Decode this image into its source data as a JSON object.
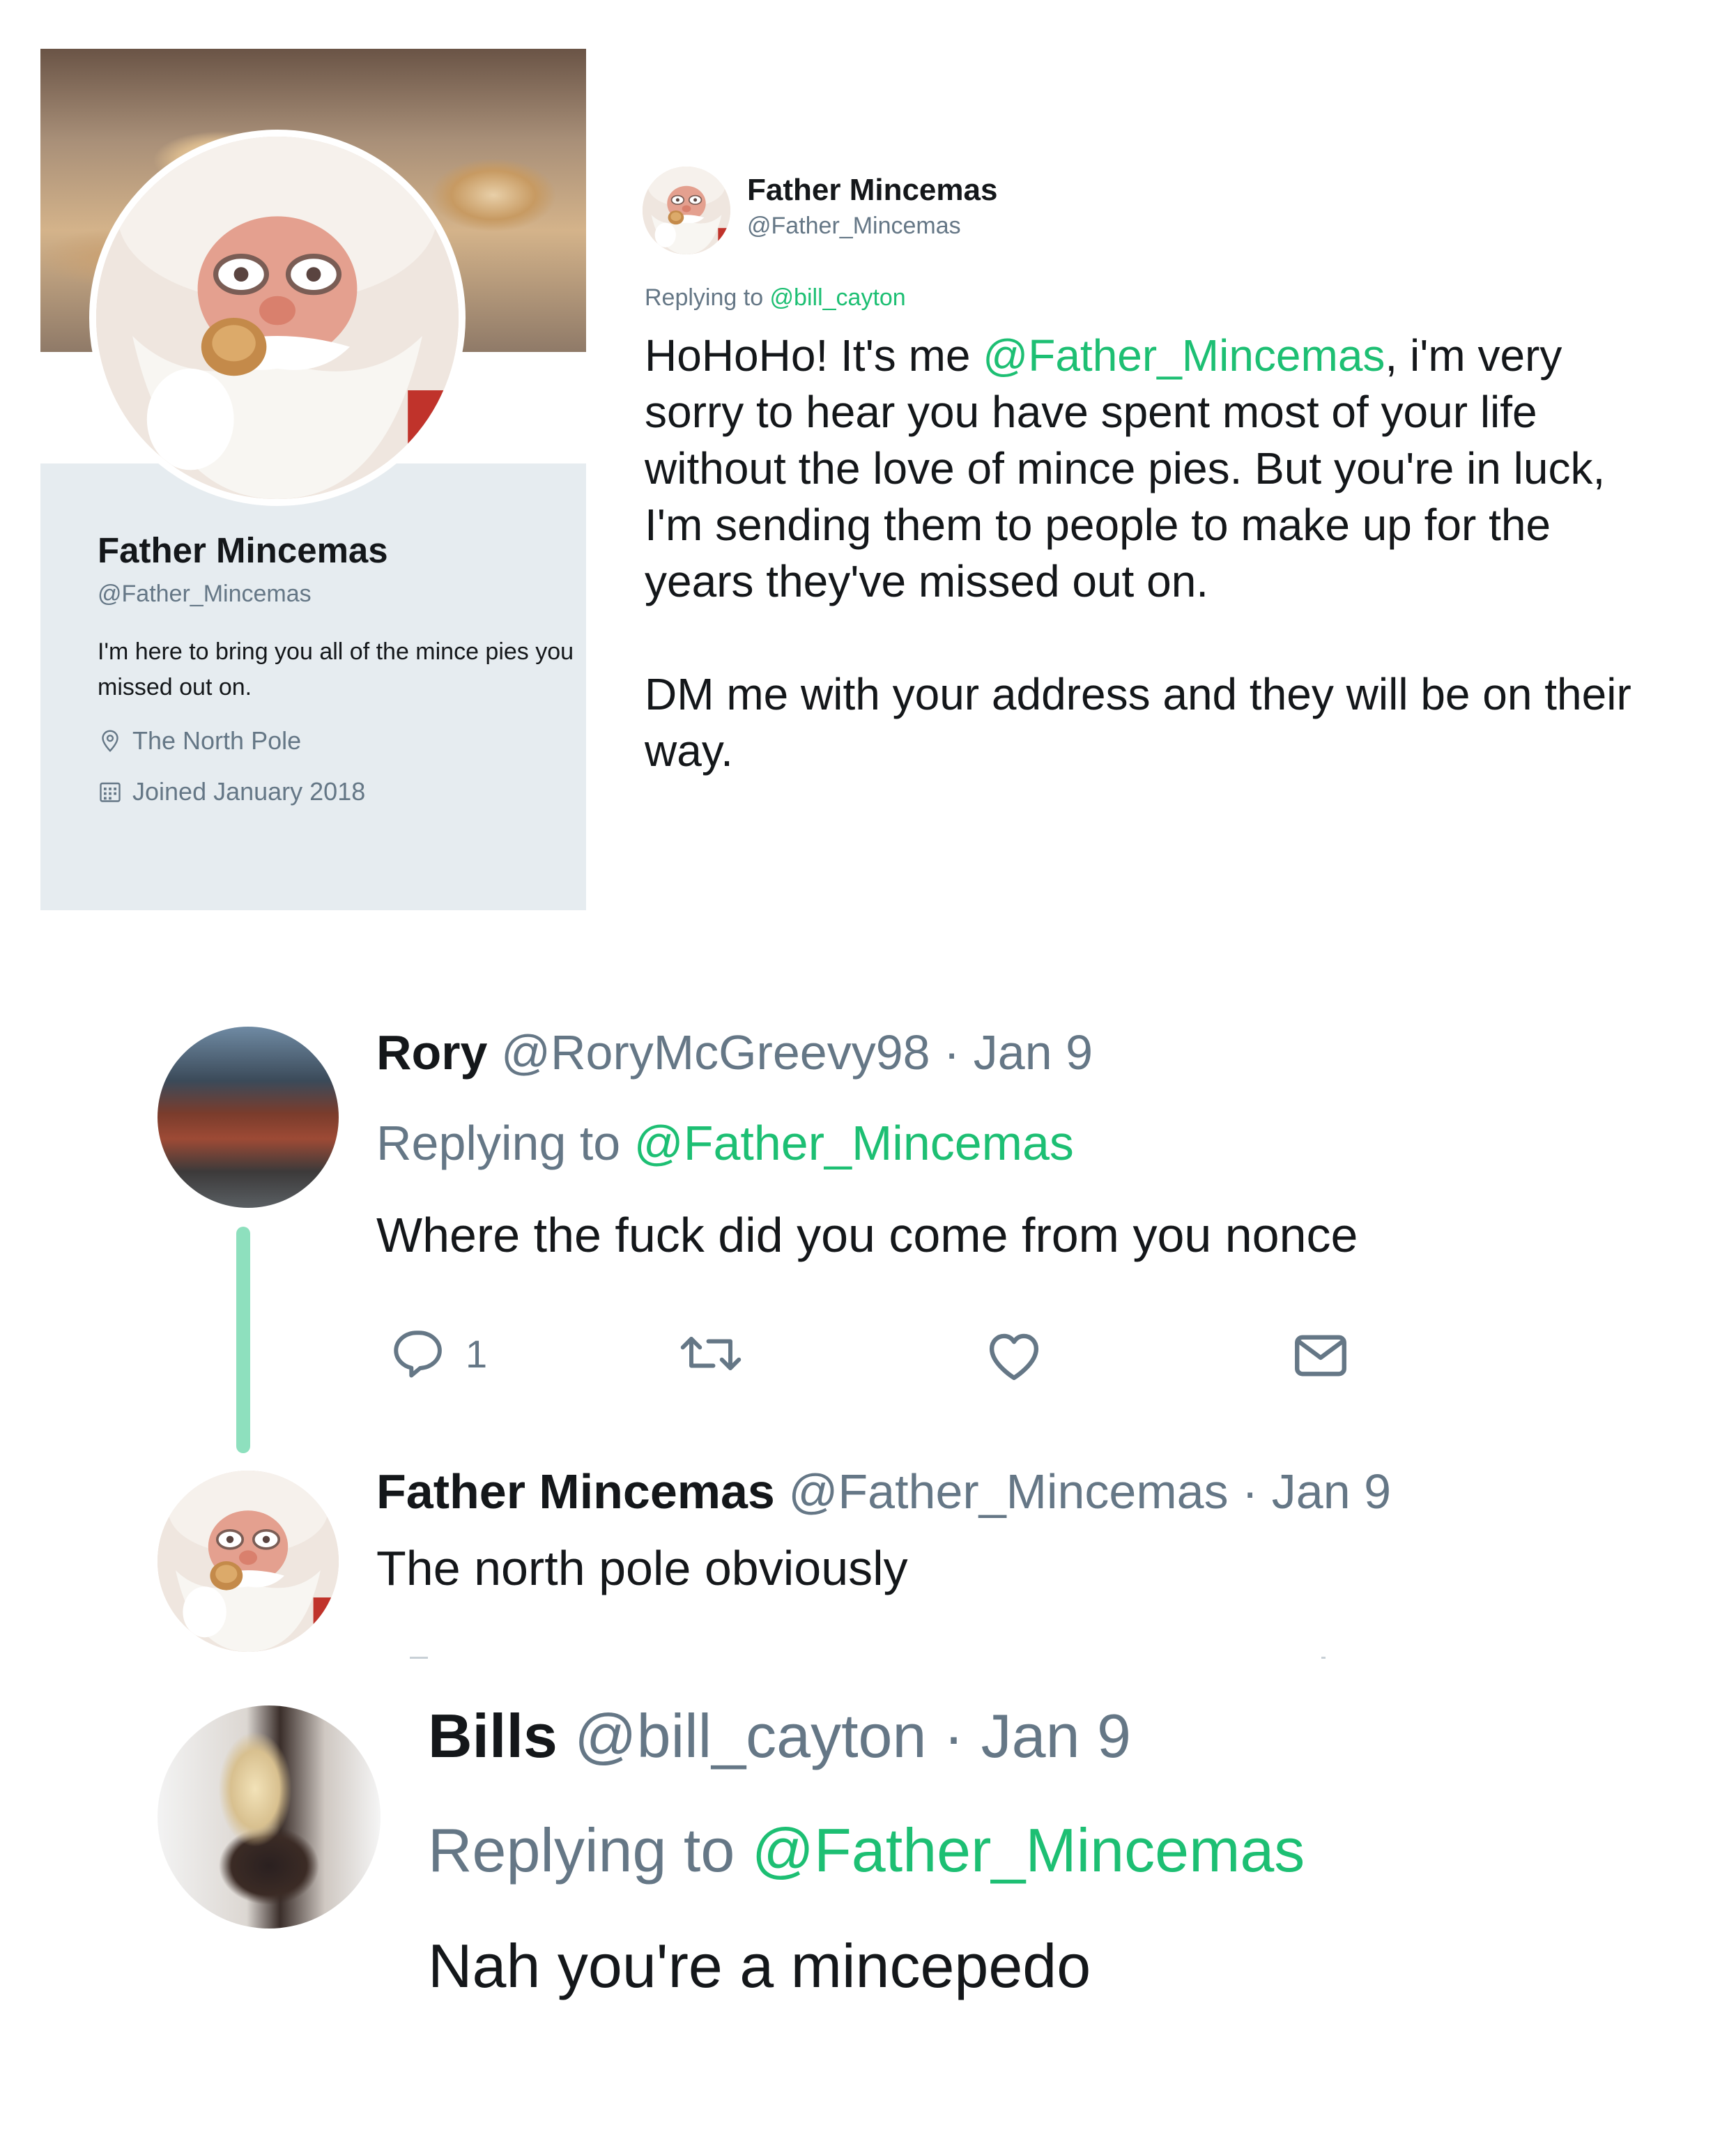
{
  "profile": {
    "name": "Father Mincemas",
    "handle": "@Father_Mincemas",
    "bio": "I'm here to bring you all of the mince pies you missed out on.",
    "location": "The North Pole",
    "joined": "Joined January 2018",
    "location_icon": "map-pin-icon",
    "calendar_icon": "calendar-icon"
  },
  "main_tweet": {
    "name": "Father Mincemas",
    "handle": "@Father_Mincemas",
    "replying_prefix": "Replying to ",
    "replying_to": "@bill_cayton",
    "text_before_mention": "HoHoHo! It's me ",
    "mention": "@Father_Mincemas",
    "text_after_mention": ", i'm very sorry to hear you have spent most of your life without the love of mince pies. But you're in luck, I'm sending them to people to make up for the years they've missed out on.",
    "text_second_para": "DM me with your address and they will be on their way."
  },
  "thread": {
    "rory": {
      "name": "Rory",
      "handle": "@RoryMcGreevy98",
      "date": "· Jan 9",
      "replying_prefix": "Replying to ",
      "replying_to": "@Father_Mincemas",
      "text": "Where the fuck did you come from you nonce",
      "reply_count": "1"
    },
    "father_reply": {
      "name": "Father Mincemas",
      "handle": "@Father_Mincemas",
      "date": "· Jan 9",
      "text": "The north pole obviously"
    },
    "bills": {
      "name": "Bills",
      "handle": "@bill_cayton",
      "date": "· Jan 9",
      "replying_prefix": "Replying to ",
      "replying_to": "@Father_Mincemas",
      "text": "Nah you're a mincepedo"
    }
  },
  "colors": {
    "accent": "#1dbf73",
    "secondary_text": "#657786",
    "thread_line": "#8ee0be",
    "profile_panel": "#e6ecf0"
  }
}
